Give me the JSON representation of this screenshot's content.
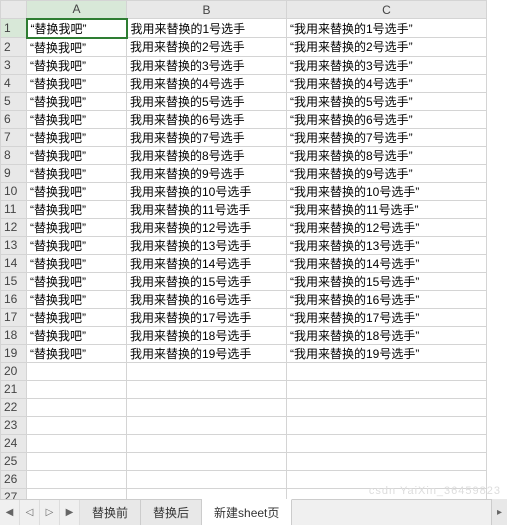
{
  "columns": [
    "A",
    "B",
    "C"
  ],
  "visible_rows": 27,
  "selected_cell": {
    "row": 1,
    "col": "A"
  },
  "rows": [
    {
      "A": "“替换我吧”",
      "B": "我用来替换的1号选手",
      "C": "“我用来替换的1号选手”"
    },
    {
      "A": "“替换我吧”",
      "B": "我用来替换的2号选手",
      "C": "“我用来替换的2号选手”"
    },
    {
      "A": "“替换我吧”",
      "B": "我用来替换的3号选手",
      "C": "“我用来替换的3号选手”"
    },
    {
      "A": "“替换我吧”",
      "B": "我用来替换的4号选手",
      "C": "“我用来替换的4号选手”"
    },
    {
      "A": "“替换我吧”",
      "B": "我用来替换的5号选手",
      "C": "“我用来替换的5号选手”"
    },
    {
      "A": "“替换我吧”",
      "B": "我用来替换的6号选手",
      "C": "“我用来替换的6号选手”"
    },
    {
      "A": "“替换我吧”",
      "B": "我用来替换的7号选手",
      "C": "“我用来替换的7号选手”"
    },
    {
      "A": "“替换我吧”",
      "B": "我用来替换的8号选手",
      "C": "“我用来替换的8号选手”"
    },
    {
      "A": "“替换我吧”",
      "B": "我用来替换的9号选手",
      "C": "“我用来替换的9号选手”"
    },
    {
      "A": "“替换我吧”",
      "B": "我用来替换的10号选手",
      "C": "“我用来替换的10号选手”"
    },
    {
      "A": "“替换我吧”",
      "B": "我用来替换的11号选手",
      "C": "“我用来替换的11号选手”"
    },
    {
      "A": "“替换我吧”",
      "B": "我用来替换的12号选手",
      "C": "“我用来替换的12号选手”"
    },
    {
      "A": "“替换我吧”",
      "B": "我用来替换的13号选手",
      "C": "“我用来替换的13号选手”"
    },
    {
      "A": "“替换我吧”",
      "B": "我用来替换的14号选手",
      "C": "“我用来替换的14号选手”"
    },
    {
      "A": "“替换我吧”",
      "B": "我用来替换的15号选手",
      "C": "“我用来替换的15号选手”"
    },
    {
      "A": "“替换我吧”",
      "B": "我用来替换的16号选手",
      "C": "“我用来替换的16号选手”"
    },
    {
      "A": "“替换我吧”",
      "B": "我用来替换的17号选手",
      "C": "“我用来替换的17号选手”"
    },
    {
      "A": "“替换我吧”",
      "B": "我用来替换的18号选手",
      "C": "“我用来替换的18号选手”"
    },
    {
      "A": "“替换我吧”",
      "B": "我用来替换的19号选手",
      "C": "“我用来替换的19号选手”"
    }
  ],
  "tabs": [
    {
      "label": "替换前",
      "active": false
    },
    {
      "label": "替换后",
      "active": false
    },
    {
      "label": "新建sheet页",
      "active": true
    }
  ],
  "nav": {
    "first": "◀",
    "prev": "◁",
    "next": "▷",
    "last": "▶"
  },
  "watermark": "csdn YaiXin_36459823"
}
